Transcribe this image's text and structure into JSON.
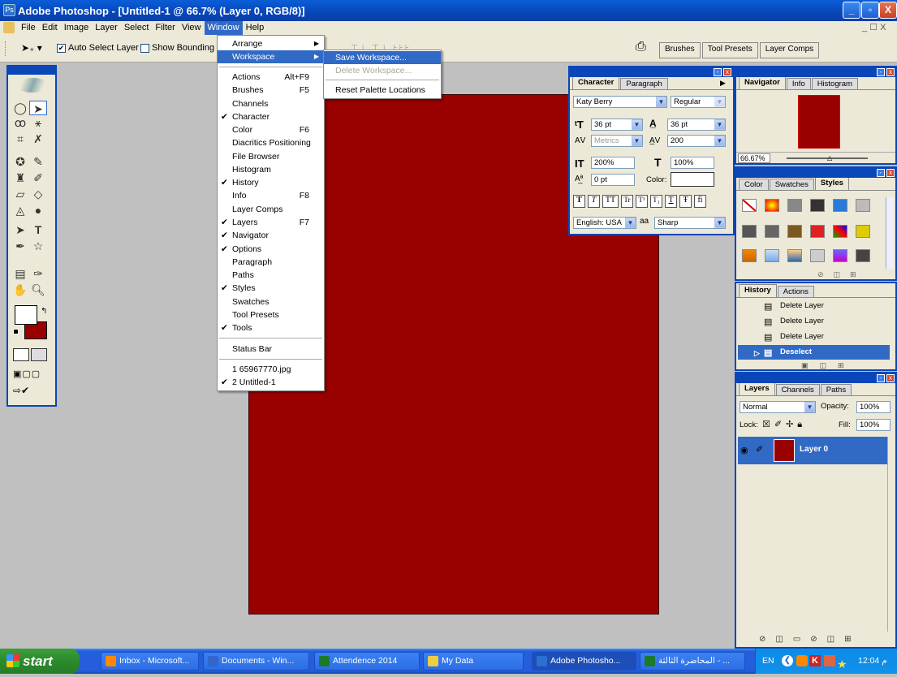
{
  "window": {
    "title": "Adobe Photoshop - [Untitled-1 @ 66.7% (Layer 0, RGB/8)]",
    "min": "_",
    "max": "▫",
    "close": "X"
  },
  "menubar": [
    "File",
    "Edit",
    "Image",
    "Layer",
    "Select",
    "Filter",
    "View",
    "Window",
    "Help"
  ],
  "doc_controls": "_ ☐ X",
  "options": {
    "auto_select": "Auto Select Layer",
    "show_bounding": "Show Bounding Bo"
  },
  "top_tabs": [
    "Brushes",
    "Tool Presets",
    "Layer Comps"
  ],
  "window_menu": {
    "items": [
      {
        "label": "Arrange",
        "check": "",
        "shortcut": "",
        "arrow": "▶"
      },
      {
        "label": "Workspace",
        "check": "",
        "shortcut": "",
        "arrow": "▶"
      },
      {
        "label": "Actions",
        "check": "",
        "shortcut": "Alt+F9",
        "arrow": ""
      },
      {
        "label": "Brushes",
        "check": "",
        "shortcut": "F5",
        "arrow": ""
      },
      {
        "label": "Channels",
        "check": "",
        "shortcut": "",
        "arrow": ""
      },
      {
        "label": "Character",
        "check": "✔",
        "shortcut": "",
        "arrow": ""
      },
      {
        "label": "Color",
        "check": "",
        "shortcut": "F6",
        "arrow": ""
      },
      {
        "label": "Diacritics Positioning",
        "check": "",
        "shortcut": "",
        "arrow": ""
      },
      {
        "label": "File Browser",
        "check": "",
        "shortcut": "",
        "arrow": ""
      },
      {
        "label": "Histogram",
        "check": "",
        "shortcut": "",
        "arrow": ""
      },
      {
        "label": "History",
        "check": "✔",
        "shortcut": "",
        "arrow": ""
      },
      {
        "label": "Info",
        "check": "",
        "shortcut": "F8",
        "arrow": ""
      },
      {
        "label": "Layer Comps",
        "check": "",
        "shortcut": "",
        "arrow": ""
      },
      {
        "label": "Layers",
        "check": "✔",
        "shortcut": "F7",
        "arrow": ""
      },
      {
        "label": "Navigator",
        "check": "✔",
        "shortcut": "",
        "arrow": ""
      },
      {
        "label": "Options",
        "check": "✔",
        "shortcut": "",
        "arrow": ""
      },
      {
        "label": "Paragraph",
        "check": "",
        "shortcut": "",
        "arrow": ""
      },
      {
        "label": "Paths",
        "check": "",
        "shortcut": "",
        "arrow": ""
      },
      {
        "label": "Styles",
        "check": "✔",
        "shortcut": "",
        "arrow": ""
      },
      {
        "label": "Swatches",
        "check": "",
        "shortcut": "",
        "arrow": ""
      },
      {
        "label": "Tool Presets",
        "check": "",
        "shortcut": "",
        "arrow": ""
      },
      {
        "label": "Tools",
        "check": "✔",
        "shortcut": "",
        "arrow": ""
      },
      {
        "label": "Status Bar",
        "check": "",
        "shortcut": "",
        "arrow": ""
      },
      {
        "label": "1 65967770.jpg",
        "check": "",
        "shortcut": "",
        "arrow": ""
      },
      {
        "label": "2 Untitled-1",
        "check": "✔",
        "shortcut": "",
        "arrow": ""
      }
    ]
  },
  "workspace_submenu": [
    "Save Workspace...",
    "Delete Workspace...",
    "Reset Palette Locations"
  ],
  "character": {
    "tabs": [
      "Character",
      "Paragraph"
    ],
    "font": "Katy Berry",
    "style": "Regular",
    "size": "36 pt",
    "leading": "36 pt",
    "kerning": "Metrics",
    "tracking": "200",
    "vscale": "200%",
    "hscale": "100%",
    "baseline": "0 pt",
    "color_label": "Color:",
    "language": "English: USA",
    "aa_label": "aa",
    "aa": "Sharp",
    "style_buttons": [
      "T",
      "T",
      "TT",
      "Tr",
      "T¹",
      "T₁",
      "T",
      "Ŧ",
      "fi"
    ]
  },
  "navigator": {
    "tabs": [
      "Navigator",
      "Info",
      "Histogram"
    ],
    "zoom": "66.67%"
  },
  "styles": {
    "tabs": [
      "Color",
      "Swatches",
      "Styles"
    ]
  },
  "history": {
    "tabs": [
      "History",
      "Actions"
    ],
    "rows": [
      "Delete Layer",
      "Delete Layer",
      "Delete Layer",
      "Deselect"
    ]
  },
  "layers": {
    "tabs": [
      "Layers",
      "Channels",
      "Paths"
    ],
    "blend": "Normal",
    "opacity_label": "Opacity:",
    "opacity": "100%",
    "lock_label": "Lock:",
    "fill_label": "Fill:",
    "fill": "100%",
    "layer_name": "Layer 0"
  },
  "colors": {
    "canvas": "#990000",
    "accent": "#0a46b8",
    "highlight": "#316ac5"
  },
  "taskbar": {
    "start": "start",
    "buttons": [
      "Inbox - Microsoft...",
      "Documents - Win...",
      "Attendence 2014",
      "My Data",
      "Adobe Photosho...",
      "المحاضرة الثالثة - ..."
    ],
    "lang": "EN",
    "clock": "12:04 م"
  }
}
